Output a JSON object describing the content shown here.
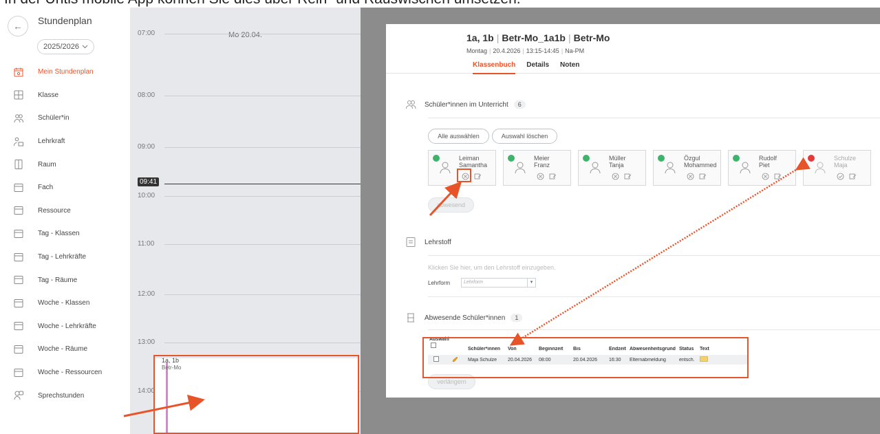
{
  "caption": "In der Untis mobile App können Sie dies über Rein- und Rauswischen umsetzen.",
  "sidebar": {
    "back_icon": "arrow-left-icon",
    "title": "Stundenplan",
    "year": "2025/2026",
    "accent_color": "#e8542a",
    "items": [
      {
        "label": "Mein Stundenplan",
        "icon": "calendar-icon",
        "active": true
      },
      {
        "label": "Klasse",
        "icon": "class-icon"
      },
      {
        "label": "Schüler*in",
        "icon": "students-icon"
      },
      {
        "label": "Lehrkraft",
        "icon": "teacher-icon"
      },
      {
        "label": "Raum",
        "icon": "door-icon"
      },
      {
        "label": "Fach",
        "icon": "subject-icon"
      },
      {
        "label": "Ressource",
        "icon": "resource-icon"
      },
      {
        "label": "Tag - Klassen",
        "icon": "day-class-icon"
      },
      {
        "label": "Tag - Lehrkräfte",
        "icon": "day-teacher-icon"
      },
      {
        "label": "Tag - Räume",
        "icon": "day-room-icon"
      },
      {
        "label": "Woche - Klassen",
        "icon": "week-class-icon"
      },
      {
        "label": "Woche - Lehrkräfte",
        "icon": "week-teacher-icon"
      },
      {
        "label": "Woche - Räume",
        "icon": "week-room-icon"
      },
      {
        "label": "Woche - Ressourcen",
        "icon": "week-resource-icon"
      },
      {
        "label": "Sprechstunden",
        "icon": "consultation-icon"
      }
    ]
  },
  "calendar": {
    "day": "Mo 20.04.",
    "times": [
      "07:00",
      "08:00",
      "09:00",
      "10:00",
      "11:00",
      "12:00",
      "13:00",
      "14:00"
    ],
    "now": "09:41",
    "lesson": {
      "line1": "1a, 1b",
      "line2": "Betr-Mo",
      "color": "#e87ad8"
    }
  },
  "panel": {
    "title": [
      "1a, 1b",
      "Betr-Mo_1a1b",
      "Betr-Mo"
    ],
    "subtitle": [
      "Montag",
      "20.4.2026",
      "13:15-14:45",
      "Na-PM"
    ],
    "tabs": [
      "Klassenbuch",
      "Details",
      "Noten"
    ],
    "students_section": {
      "title": "Schüler*innen im Unterricht",
      "count": "6"
    },
    "select_all": "Alle auswählen",
    "clear_selection": "Auswahl löschen",
    "absent_button": "abwesend",
    "students": [
      {
        "first": "Leiman",
        "second": "Samantha",
        "present": true
      },
      {
        "first": "Meier",
        "second": "Franz",
        "present": true
      },
      {
        "first": "Müller",
        "second": "Tanja",
        "present": true
      },
      {
        "first": "Özgul",
        "second": "Mohammed",
        "present": true
      },
      {
        "first": "Rudolf",
        "second": "Piet",
        "present": true
      },
      {
        "first": "Schulze",
        "second": "Maja",
        "present": false
      }
    ],
    "lehrstoff": {
      "title": "Lehrstoff",
      "hint": "Klicken Sie hier, um den Lehrstoff einzugeben.",
      "lehrform_label": "Lehrform",
      "lehrform_placeholder": "Lehrform"
    },
    "absent_section": {
      "title": "Abwesende Schüler*innen",
      "count": "1"
    },
    "absent_table": {
      "auswahl": "Auswahl",
      "headers": [
        "Schüler*innen",
        "Von",
        "Beginnzeit",
        "Bis",
        "Endzeit",
        "Abwesenheitsgrund",
        "Status",
        "Text"
      ],
      "row": [
        "Maja Schulze",
        "20.04.2026",
        "08:00",
        "20.04.2026",
        "16:30",
        "Elternabmeldung",
        "entsch.",
        ""
      ]
    },
    "extend_button": "verlängern"
  }
}
